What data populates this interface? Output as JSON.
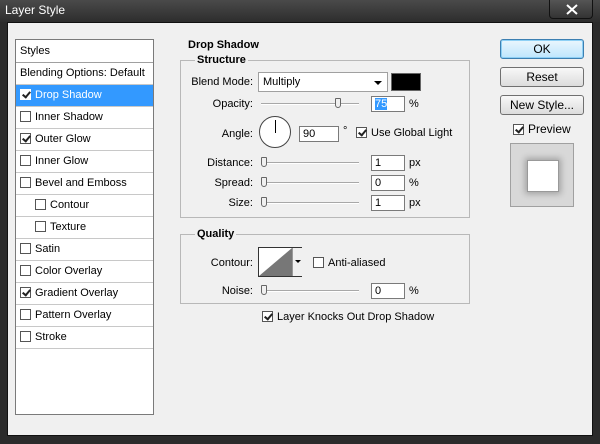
{
  "window": {
    "title": "Layer Style"
  },
  "styles_panel": {
    "header": "Styles",
    "items": [
      {
        "label": "Blending Options: Default",
        "checkbox": false,
        "checked": false,
        "selected": false,
        "indent": false
      },
      {
        "label": "Drop Shadow",
        "checkbox": true,
        "checked": true,
        "selected": true,
        "indent": false
      },
      {
        "label": "Inner Shadow",
        "checkbox": true,
        "checked": false,
        "selected": false,
        "indent": false
      },
      {
        "label": "Outer Glow",
        "checkbox": true,
        "checked": true,
        "selected": false,
        "indent": false
      },
      {
        "label": "Inner Glow",
        "checkbox": true,
        "checked": false,
        "selected": false,
        "indent": false
      },
      {
        "label": "Bevel and Emboss",
        "checkbox": true,
        "checked": false,
        "selected": false,
        "indent": false
      },
      {
        "label": "Contour",
        "checkbox": true,
        "checked": false,
        "selected": false,
        "indent": true
      },
      {
        "label": "Texture",
        "checkbox": true,
        "checked": false,
        "selected": false,
        "indent": true
      },
      {
        "label": "Satin",
        "checkbox": true,
        "checked": false,
        "selected": false,
        "indent": false
      },
      {
        "label": "Color Overlay",
        "checkbox": true,
        "checked": false,
        "selected": false,
        "indent": false
      },
      {
        "label": "Gradient Overlay",
        "checkbox": true,
        "checked": true,
        "selected": false,
        "indent": false
      },
      {
        "label": "Pattern Overlay",
        "checkbox": true,
        "checked": false,
        "selected": false,
        "indent": false
      },
      {
        "label": "Stroke",
        "checkbox": true,
        "checked": false,
        "selected": false,
        "indent": false
      }
    ]
  },
  "drop_shadow": {
    "section_title": "Drop Shadow",
    "structure": {
      "title": "Structure",
      "blend_mode_label": "Blend Mode:",
      "blend_mode_value": "Multiply",
      "shadow_color": "#000000",
      "opacity_label": "Opacity:",
      "opacity_value": "75",
      "opacity_unit": "%",
      "opacity_level": 0.75,
      "angle_label": "Angle:",
      "angle_value": "90",
      "angle_unit": "°",
      "use_global_light_label": "Use Global Light",
      "use_global_light": true,
      "distance_label": "Distance:",
      "distance_value": "1",
      "distance_unit": "px",
      "spread_label": "Spread:",
      "spread_value": "0",
      "spread_unit": "%",
      "size_label": "Size:",
      "size_value": "1",
      "size_unit": "px"
    },
    "quality": {
      "title": "Quality",
      "contour_label": "Contour:",
      "anti_aliased_label": "Anti-aliased",
      "anti_aliased": false,
      "noise_label": "Noise:",
      "noise_value": "0",
      "noise_unit": "%"
    },
    "knocks_out_label": "Layer Knocks Out Drop Shadow",
    "knocks_out": true
  },
  "buttons": {
    "ok": "OK",
    "reset": "Reset",
    "new_style": "New Style..."
  },
  "preview": {
    "label": "Preview",
    "checked": true
  }
}
